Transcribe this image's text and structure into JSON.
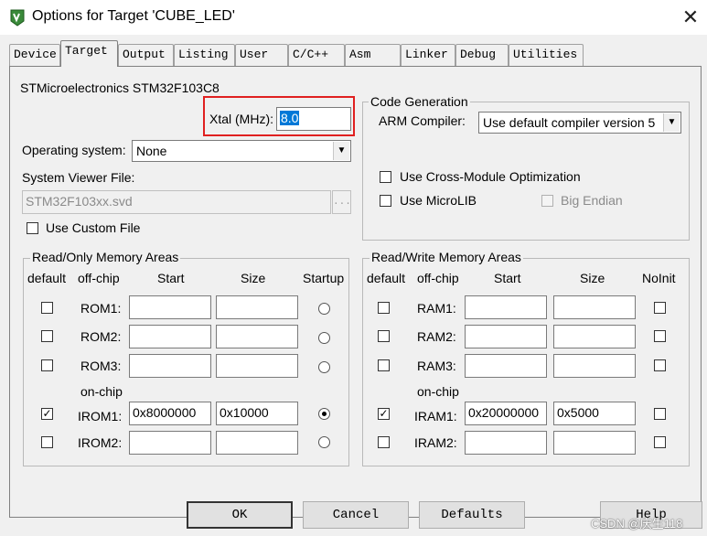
{
  "window": {
    "title": "Options for Target 'CUBE_LED'",
    "close_glyph": "✕"
  },
  "tabs": [
    "Device",
    "Target",
    "Output",
    "Listing",
    "User",
    "C/C++",
    "Asm",
    "Linker",
    "Debug",
    "Utilities"
  ],
  "active_tab": "Target",
  "device_name": "STMicroelectronics STM32F103C8",
  "xtal": {
    "label": "Xtal (MHz):",
    "value": "8.0"
  },
  "os": {
    "label": "Operating system:",
    "value": "None"
  },
  "svd": {
    "label": "System Viewer File:",
    "value": "STM32F103xx.svd",
    "browse": "...",
    "custom_label": "Use Custom File",
    "custom_checked": false
  },
  "codegen": {
    "title": "Code Generation",
    "compiler_label": "ARM Compiler:",
    "compiler_value": "Use default compiler version 5",
    "cross_module_label": "Use Cross-Module Optimization",
    "microlib_label": "Use MicroLIB",
    "big_endian_label": "Big Endian"
  },
  "rom": {
    "title": "Read/Only Memory Areas",
    "headers": {
      "default": "default",
      "offchip": "off-chip",
      "start": "Start",
      "size": "Size",
      "extra": "Startup"
    },
    "onchip_label": "on-chip",
    "rows": [
      {
        "name": "ROM1:",
        "start": "",
        "size": "",
        "checked": false,
        "startup": false
      },
      {
        "name": "ROM2:",
        "start": "",
        "size": "",
        "checked": false,
        "startup": false
      },
      {
        "name": "ROM3:",
        "start": "",
        "size": "",
        "checked": false,
        "startup": false
      },
      {
        "name": "IROM1:",
        "start": "0x8000000",
        "size": "0x10000",
        "checked": true,
        "startup": true
      },
      {
        "name": "IROM2:",
        "start": "",
        "size": "",
        "checked": false,
        "startup": false
      }
    ]
  },
  "ram": {
    "title": "Read/Write Memory Areas",
    "headers": {
      "default": "default",
      "offchip": "off-chip",
      "start": "Start",
      "size": "Size",
      "extra": "NoInit"
    },
    "onchip_label": "on-chip",
    "rows": [
      {
        "name": "RAM1:",
        "start": "",
        "size": "",
        "checked": false,
        "noinit": false
      },
      {
        "name": "RAM2:",
        "start": "",
        "size": "",
        "checked": false,
        "noinit": false
      },
      {
        "name": "RAM3:",
        "start": "",
        "size": "",
        "checked": false,
        "noinit": false
      },
      {
        "name": "IRAM1:",
        "start": "0x20000000",
        "size": "0x5000",
        "checked": true,
        "noinit": false
      },
      {
        "name": "IRAM2:",
        "start": "",
        "size": "",
        "checked": false,
        "noinit": false
      }
    ]
  },
  "buttons": {
    "ok": "OK",
    "cancel": "Cancel",
    "defaults": "Defaults",
    "help": "Help"
  },
  "watermark": "CSDN @庆生118",
  "colors": {
    "highlight": "#e02020",
    "selection": "#0078d7"
  }
}
